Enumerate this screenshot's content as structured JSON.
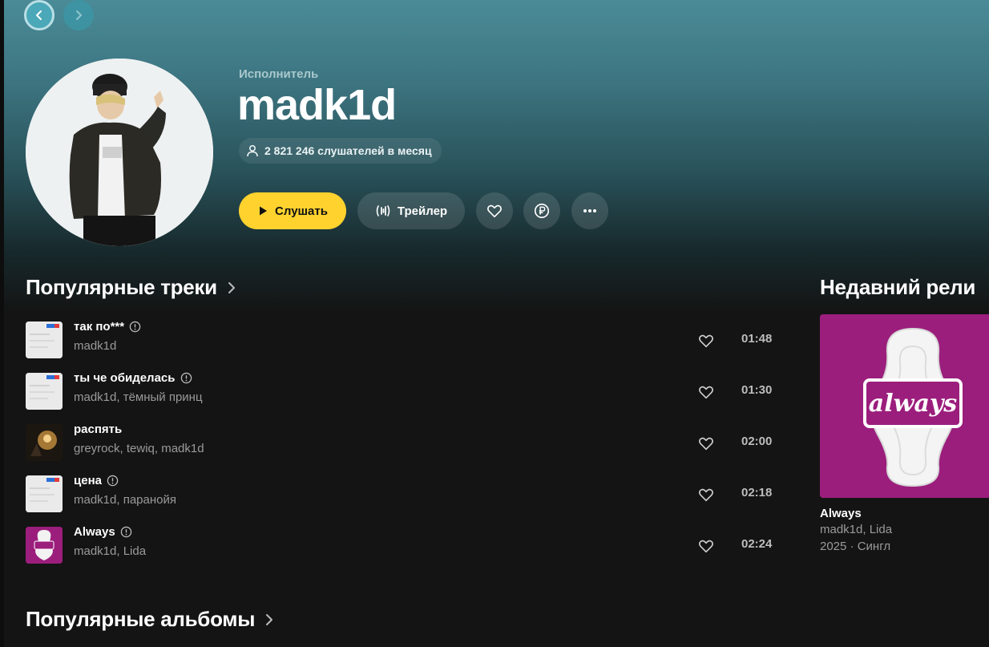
{
  "nav": {
    "back_icon": "chevron-left-icon",
    "forward_icon": "chevron-right-icon"
  },
  "artist": {
    "type_label": "Исполнитель",
    "name": "madk1d",
    "listeners": "2 821 246 слушателей в месяц"
  },
  "actions": {
    "play_label": "Слушать",
    "trailer_label": "Трейлер"
  },
  "colors": {
    "accent": "#ffd22e",
    "hero": "#3d7682",
    "background": "#141414",
    "always_magenta": "#9b1e7c"
  },
  "popular_tracks": {
    "title": "Популярные треки",
    "items": [
      {
        "title": "так по***",
        "artists": "madk1d",
        "duration": "01:48",
        "explicit": true,
        "cover": "doc"
      },
      {
        "title": "ты че обиделась",
        "artists": "madk1d, тёмный принц",
        "duration": "01:30",
        "explicit": true,
        "cover": "doc"
      },
      {
        "title": "распять",
        "artists": "greyrock, tewiq, madk1d",
        "duration": "02:00",
        "explicit": false,
        "cover": "dark"
      },
      {
        "title": "цена",
        "artists": "madk1d, паранойя",
        "duration": "02:18",
        "explicit": true,
        "cover": "doc"
      },
      {
        "title": "Always",
        "artists": "madk1d, Lida",
        "duration": "02:24",
        "explicit": true,
        "cover": "always"
      }
    ]
  },
  "recent_release": {
    "section_title": "Недавний рели",
    "cover_text": "always",
    "title": "Always",
    "artists": "madk1d, Lida",
    "meta": "2025 · Сингл"
  },
  "popular_albums": {
    "title": "Популярные альбомы"
  },
  "cover_doc_text": "Ма"
}
